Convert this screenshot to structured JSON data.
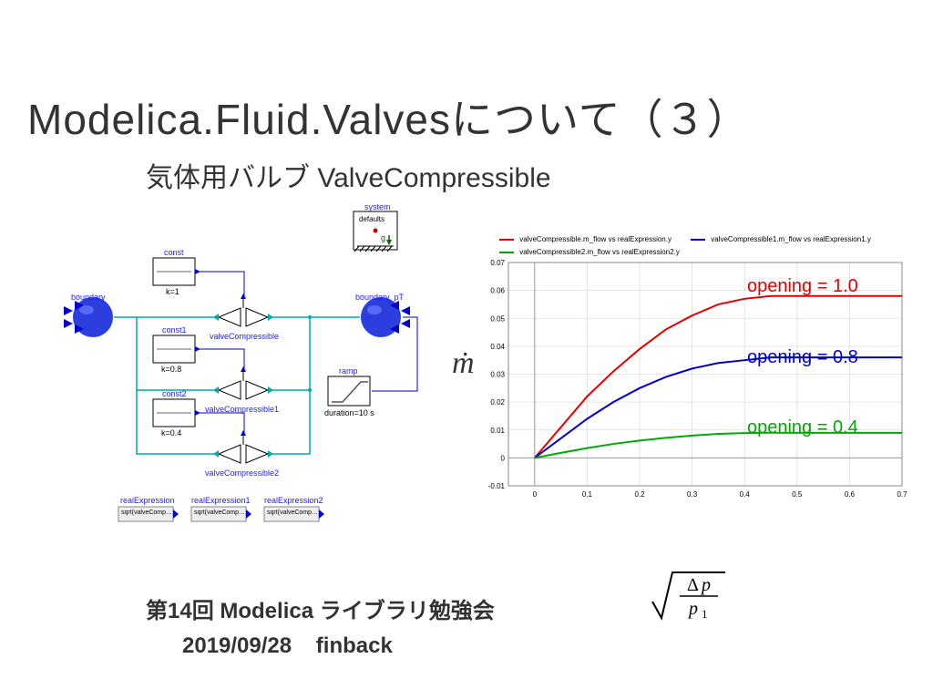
{
  "title": "Modelica.Fluid.Valvesについて（３）",
  "subtitle": "気体用バルブ ValveCompressible",
  "footer_line1": "第14回 Modelica ライブラリ勉強会",
  "footer_date": "2019/09/28",
  "footer_author": "finback",
  "diagram": {
    "system": "system",
    "system_defaults": "defaults",
    "system_g": "g",
    "boundary": "boundary",
    "boundary_pT": "boundary_pT",
    "const": "const",
    "const1": "const1",
    "const2": "const2",
    "k1": "k=1",
    "k08": "k=0.8",
    "k04": "k=0.4",
    "valveCompressible": "valveCompressible",
    "valveCompressible1": "valveCompressible1",
    "valveCompressible2": "valveCompressible2",
    "ramp": "ramp",
    "duration": "duration=10 s",
    "realExpression": "realExpression",
    "realExpression1": "realExpression1",
    "realExpression2": "realExpression2",
    "sqrt": "sqrt(valveComp…"
  },
  "mdot": "ṁ",
  "chart": {
    "legend1": "valveCompressible.m_flow vs realExpression.y",
    "legend2": "valveCompressible1.m_flow vs realExpression1.y",
    "legend3": "valveCompressible2.m_flow vs realExpression2.y",
    "annot1": "opening = 1.0",
    "annot2": "opening = 0.8",
    "annot3": "opening = 0.4",
    "annot1_color": "#e60000",
    "annot2_color": "#0000cc",
    "annot3_color": "#00aa00"
  },
  "chart_data": {
    "type": "line",
    "xlabel": "",
    "ylabel": "",
    "xlim": [
      -0.05,
      0.7
    ],
    "ylim": [
      -0.01,
      0.07
    ],
    "xticks": [
      0,
      0.1,
      0.2,
      0.3,
      0.4,
      0.5,
      0.6,
      0.7
    ],
    "yticks": [
      -0.01,
      0,
      0.01,
      0.02,
      0.03,
      0.04,
      0.05,
      0.06,
      0.07
    ],
    "x": [
      0,
      0.05,
      0.1,
      0.15,
      0.2,
      0.25,
      0.3,
      0.35,
      0.4,
      0.45,
      0.5,
      0.55,
      0.6,
      0.65,
      0.7
    ],
    "series": [
      {
        "name": "opening = 1.0",
        "color": "#e60000",
        "values": [
          0,
          0.011,
          0.022,
          0.031,
          0.039,
          0.046,
          0.051,
          0.055,
          0.057,
          0.058,
          0.058,
          0.058,
          0.058,
          0.058,
          0.058
        ]
      },
      {
        "name": "opening = 0.8",
        "color": "#0000cc",
        "values": [
          0,
          0.007,
          0.014,
          0.02,
          0.025,
          0.029,
          0.032,
          0.034,
          0.035,
          0.036,
          0.036,
          0.036,
          0.036,
          0.036,
          0.036
        ]
      },
      {
        "name": "opening = 0.4",
        "color": "#00aa00",
        "values": [
          0,
          0.0018,
          0.0035,
          0.005,
          0.0062,
          0.0072,
          0.008,
          0.0086,
          0.0089,
          0.009,
          0.009,
          0.009,
          0.009,
          0.009,
          0.009
        ]
      }
    ]
  },
  "equation": {
    "numerator": "Δp",
    "denominator": "p₁"
  }
}
